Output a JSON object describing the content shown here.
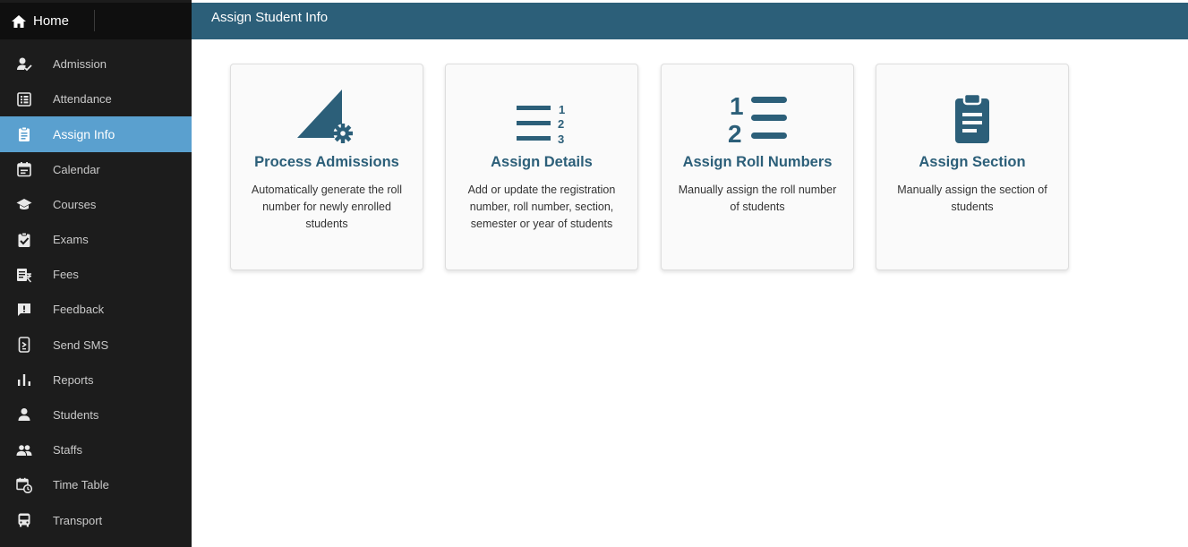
{
  "sidebar": {
    "home_label": "Home",
    "items": [
      {
        "label": "Admission",
        "icon": "person-check-icon"
      },
      {
        "label": "Attendance",
        "icon": "list-box-icon"
      },
      {
        "label": "Assign Info",
        "icon": "clipboard-icon",
        "active": true
      },
      {
        "label": "Calendar",
        "icon": "calendar-icon"
      },
      {
        "label": "Courses",
        "icon": "graduation-cap-icon"
      },
      {
        "label": "Exams",
        "icon": "clipboard-check-icon"
      },
      {
        "label": "Fees",
        "icon": "rupee-receipt-icon"
      },
      {
        "label": "Feedback",
        "icon": "feedback-icon"
      },
      {
        "label": "Send SMS",
        "icon": "phone-message-icon"
      },
      {
        "label": "Reports",
        "icon": "bar-chart-icon"
      },
      {
        "label": "Students",
        "icon": "person-icon"
      },
      {
        "label": "Staffs",
        "icon": "people-icon"
      },
      {
        "label": "Time Table",
        "icon": "calendar-clock-icon"
      },
      {
        "label": "Transport",
        "icon": "bus-icon"
      }
    ]
  },
  "header": {
    "title": "Assign Student Info"
  },
  "cards": [
    {
      "title": "Process Admissions",
      "description": "Automatically generate the roll number for newly enrolled students",
      "icon": "ruler-gear-icon"
    },
    {
      "title": "Assign Details",
      "description": "Add or update the registration number, roll number, section, semester or year of students",
      "icon": "numbered-list-icon"
    },
    {
      "title": "Assign Roll Numbers",
      "description": "Manually assign the roll number of students",
      "icon": "ordered-list-icon"
    },
    {
      "title": "Assign Section",
      "description": "Manually assign the section of students",
      "icon": "clipboard-text-icon"
    }
  ],
  "colors": {
    "sidebar": "#1c1c1c",
    "active": "#5aa0cf",
    "header": "#2c5f79",
    "accent": "#2c5f79"
  }
}
